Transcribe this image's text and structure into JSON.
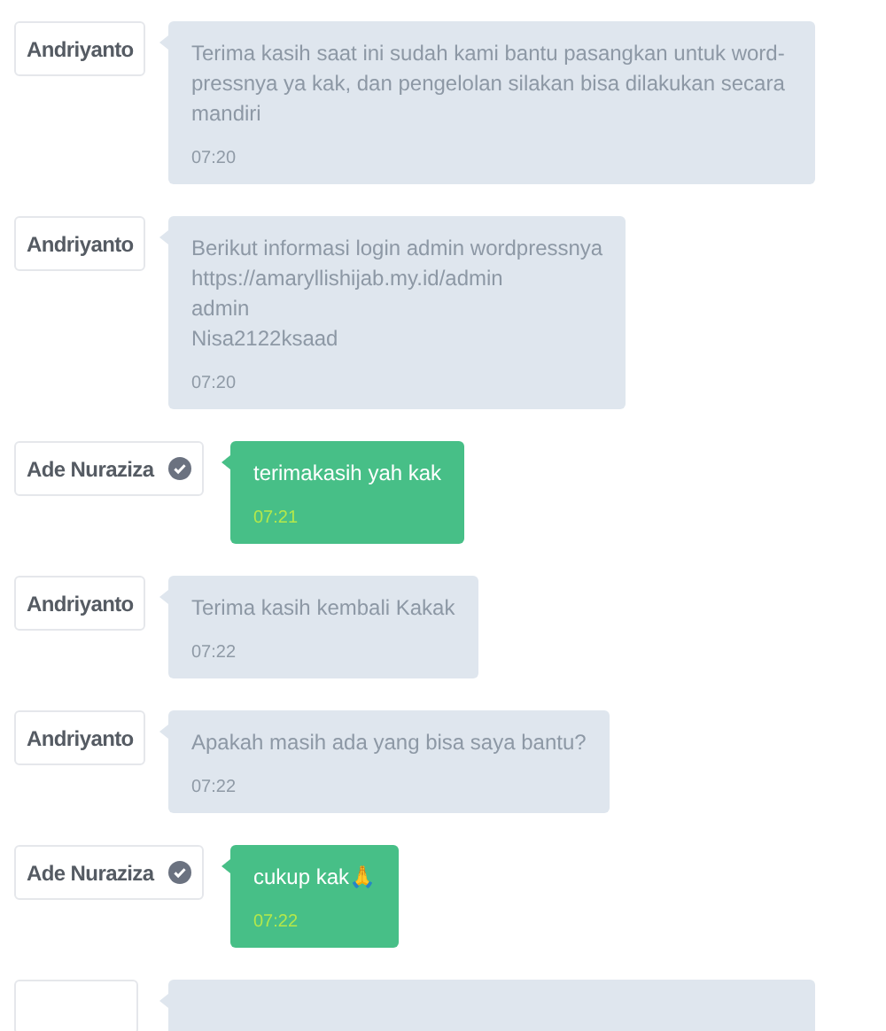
{
  "messages": [
    {
      "kind": "agent",
      "sender": "Andriyanto",
      "verified": false,
      "lines": [
        "Terima kasih saat ini sudah kami bantu pasangkan untuk word-pressnya ya kak, dan pengelolan silakan bisa dilakukan secara mandiri"
      ],
      "time": "07:20"
    },
    {
      "kind": "agent",
      "sender": "Andriyanto",
      "verified": false,
      "lines": [
        "Berikut informasi login admin wordpressnya",
        "https://amaryllishijab.my.id/admin",
        "admin",
        "Nisa2122ksaad"
      ],
      "time": "07:20"
    },
    {
      "kind": "customer",
      "sender": "Ade Nuraziza",
      "verified": true,
      "lines": [
        "terimakasih yah kak"
      ],
      "time": "07:21"
    },
    {
      "kind": "agent",
      "sender": "Andriyanto",
      "verified": false,
      "lines": [
        "Terima kasih kembali Kakak"
      ],
      "time": "07:22"
    },
    {
      "kind": "agent",
      "sender": "Andriyanto",
      "verified": false,
      "lines": [
        "Apakah masih ada yang bisa saya bantu?"
      ],
      "time": "07:22"
    },
    {
      "kind": "customer",
      "sender": "Ade Nuraziza",
      "verified": true,
      "lines": [
        "cukup kak🙏"
      ],
      "time": "07:22"
    },
    {
      "kind": "agent"
    }
  ]
}
